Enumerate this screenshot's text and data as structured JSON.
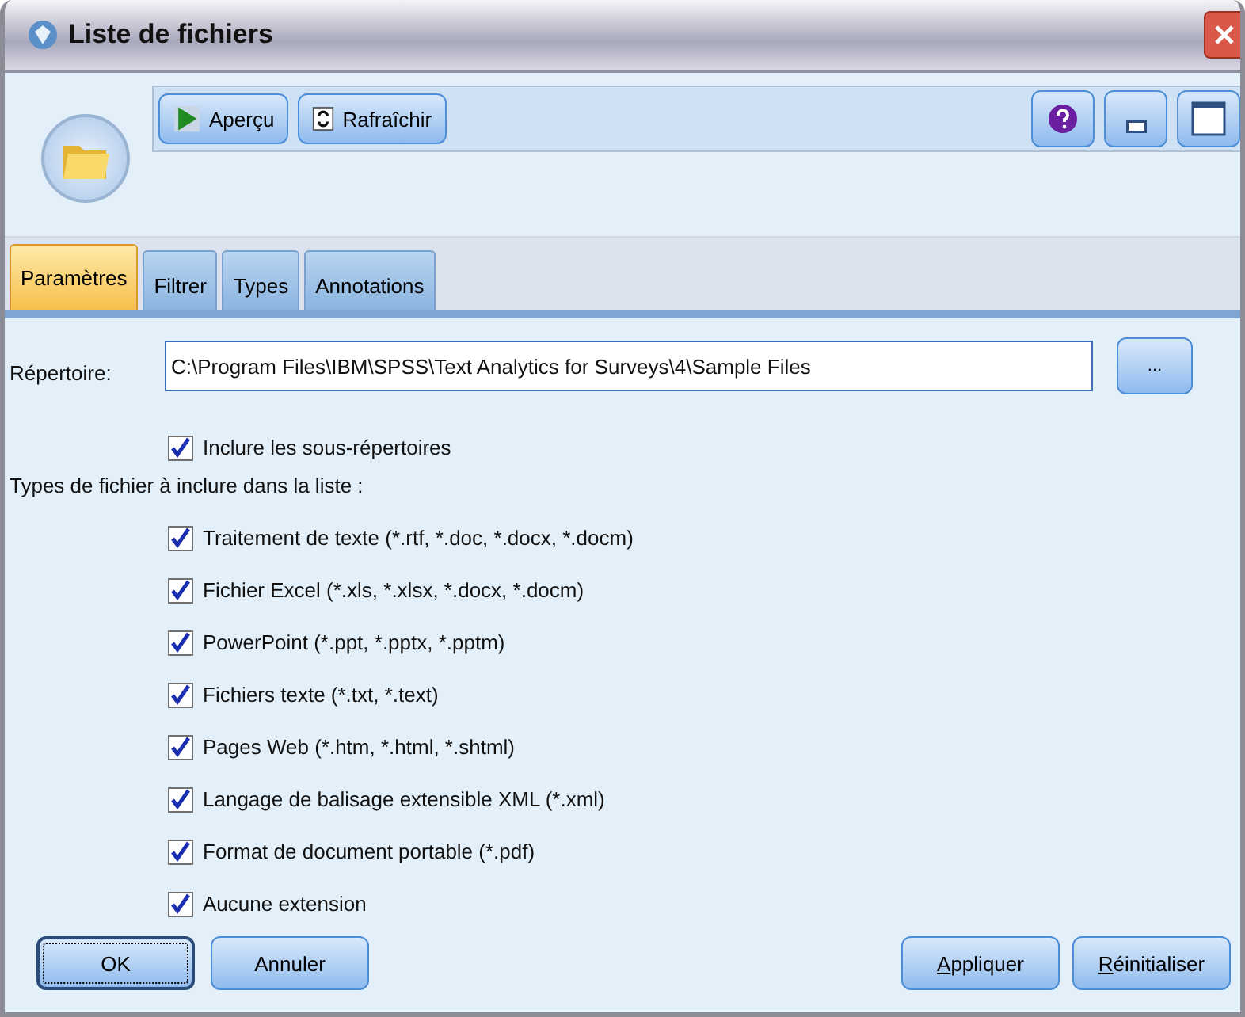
{
  "window": {
    "title": "Liste de fichiers"
  },
  "toolbar": {
    "buttons": [
      {
        "label": "Aperçu",
        "kind": "preview"
      },
      {
        "label": "Rafraîchir",
        "kind": "refresh"
      }
    ]
  },
  "tabs": [
    {
      "label": "Paramètres",
      "selected": true
    },
    {
      "label": "Filtrer",
      "selected": false
    },
    {
      "label": "Types",
      "selected": false
    },
    {
      "label": "Annotations",
      "selected": false
    }
  ],
  "directory": {
    "label": "Répertoire:",
    "value": "C:\\Program Files\\IBM\\SPSS\\Text Analytics for Surveys\\4\\Sample Files",
    "browse": "..."
  },
  "include_subdirs": {
    "label": "Inclure les sous-répertoires",
    "checked": true
  },
  "file_types": {
    "label": "Types de fichier à inclure dans la liste :",
    "items": [
      {
        "label": "Traitement de texte (*.rtf, *.doc, *.docx, *.docm)",
        "checked": true
      },
      {
        "label": "Fichier Excel (*.xls, *.xlsx, *.docx, *.docm)",
        "checked": true
      },
      {
        "label": "PowerPoint (*.ppt, *.pptx, *.pptm)",
        "checked": true
      },
      {
        "label": "Fichiers texte (*.txt, *.text)",
        "checked": true
      },
      {
        "label": "Pages Web (*.htm, *.html, *.shtml)",
        "checked": true
      },
      {
        "label": "Langage de balisage extensible XML (*.xml)",
        "checked": true
      },
      {
        "label": "Format de document portable (*.pdf)",
        "checked": true
      },
      {
        "label": "Aucune extension",
        "checked": true
      }
    ]
  },
  "footer": {
    "left": [
      {
        "label": "OK",
        "default": true
      },
      {
        "label": "Annuler",
        "default": false
      }
    ],
    "right": [
      {
        "label": "Appliquer",
        "mnemonic": true
      },
      {
        "label": "Réinitialiser",
        "mnemonic": true
      }
    ]
  }
}
